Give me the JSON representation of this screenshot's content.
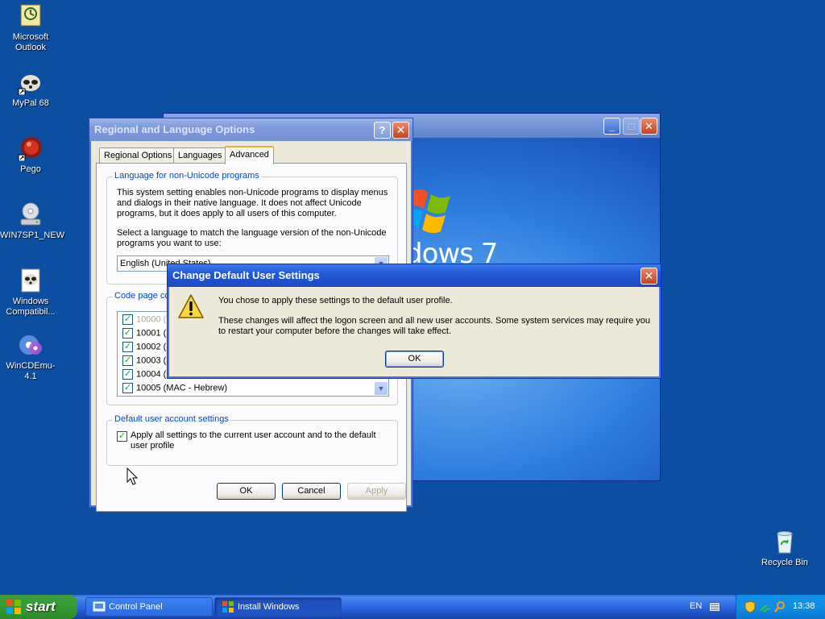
{
  "desktop": {
    "icons": [
      {
        "label": "Microsoft\nOutlook"
      },
      {
        "label": "MyPal 68"
      },
      {
        "label": "Pego"
      },
      {
        "label": "WIN7SP1_NEW"
      },
      {
        "label": "Windows\nCompatibil..."
      },
      {
        "label": "WinCDEmu-4.1"
      },
      {
        "label": "Recycle Bin"
      }
    ],
    "background_color": "#0b4ea2"
  },
  "installer_window": {
    "logo_text": "dows 7"
  },
  "regional_dialog": {
    "title": "Regional and Language Options",
    "tabs": [
      "Regional Options",
      "Languages",
      "Advanced"
    ],
    "active_tab": "Advanced",
    "non_unicode": {
      "group_label": "Language for non-Unicode programs",
      "description": "This system setting enables non-Unicode programs to display menus and dialogs in their native language. It does not affect Unicode programs, but it does apply to all users of this computer.",
      "prompt": "Select a language to match the language version of the non-Unicode programs you want to use:",
      "selected_language": "English (United States)"
    },
    "code_page": {
      "group_label": "Code page co",
      "items": [
        {
          "text": "10000 (",
          "checked": true
        },
        {
          "text": "10001 (",
          "checked": true
        },
        {
          "text": "10002 (",
          "checked": true
        },
        {
          "text": "10003 (",
          "checked": true
        },
        {
          "text": "10004 (",
          "checked": true
        },
        {
          "text": "10005 (MAC - Hebrew)",
          "checked": true
        }
      ]
    },
    "default_user": {
      "group_label": "Default user account settings",
      "checkbox_label": "Apply all settings to the current user account and to the default user profile",
      "checked": true
    },
    "buttons": {
      "ok": "OK",
      "cancel": "Cancel",
      "apply": "Apply"
    }
  },
  "message_box": {
    "title": "Change Default User Settings",
    "line1": "You chose to apply these settings to the default user profile.",
    "line2": "These changes will affect the logon screen and all new user accounts. Some system services may require you to restart your computer before the changes will take effect.",
    "ok_label": "OK",
    "icon": "warning-icon"
  },
  "taskbar": {
    "start_label": "start",
    "tasks": [
      {
        "label": "Control Panel",
        "active": false
      },
      {
        "label": "Install Windows",
        "active": true
      }
    ],
    "language": "EN",
    "clock": "13:38"
  }
}
